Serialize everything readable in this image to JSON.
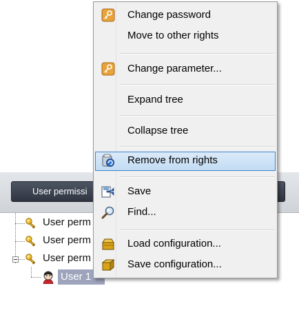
{
  "toolbar": {
    "permissions_button_label": "User permissi"
  },
  "tree": {
    "items": [
      {
        "label": "User perm",
        "icon": "key-icon"
      },
      {
        "label": "User perm",
        "icon": "key-icon"
      },
      {
        "label": "User perm",
        "icon": "key-icon",
        "expanded": true
      }
    ],
    "selected_user": {
      "label": "User 1",
      "icon": "user-avatar-icon"
    }
  },
  "context_menu": {
    "items": [
      {
        "label": "Change password",
        "icon": "key-icon"
      },
      {
        "label": "Move to other rights",
        "icon": ""
      },
      {
        "label": "Change parameter...",
        "icon": "key-icon"
      },
      {
        "label": "Expand tree",
        "icon": ""
      },
      {
        "label": "Collapse tree",
        "icon": ""
      },
      {
        "label": "Remove from rights",
        "icon": "remove-icon",
        "highlighted": true
      },
      {
        "label": "Save",
        "icon": "save-icon"
      },
      {
        "label": "Find...",
        "icon": "magnifier-icon"
      },
      {
        "label": "Load configuration...",
        "icon": "box-open-icon"
      },
      {
        "label": "Save configuration...",
        "icon": "box-closed-icon"
      }
    ]
  },
  "colors": {
    "toolbar_button": "#3b424e",
    "selection": "#9da4bc",
    "menu_highlight": "#c9e0f7",
    "menu_highlight_border": "#3d82c6",
    "key_orange": "#e49b2a"
  }
}
